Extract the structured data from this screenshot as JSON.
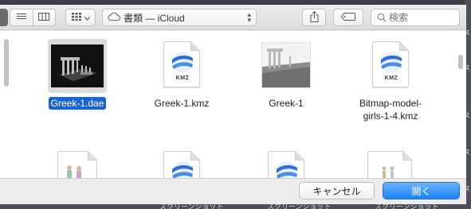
{
  "toolbar": {
    "location": "書類 — iCloud",
    "search_placeholder": "検索"
  },
  "files": [
    {
      "name": "Greek-1.dae",
      "type": "dae",
      "selected": true
    },
    {
      "name": "Greek-1.kmz",
      "type": "kmz",
      "badge": "KMZ"
    },
    {
      "name": "Greek-1",
      "type": "model"
    },
    {
      "name": "Bitmap-model-girls-1-4.kmz",
      "name_lines": [
        "Bitmap-model-",
        "girls-1-4.kmz"
      ],
      "type": "kmz",
      "badge": "KMZ"
    },
    {
      "name": "",
      "type": "figures-doc"
    },
    {
      "name": "",
      "type": "kmz"
    },
    {
      "name": "",
      "type": "kmz"
    },
    {
      "name": "",
      "type": "figures-doc"
    }
  ],
  "footer": {
    "cancel_label": "キャンセル",
    "open_label": "開く"
  },
  "desktop": {
    "labels": [
      "スクリーンショット",
      "スクリーンショット",
      "スクリーンショット",
      "スクリーンショット"
    ]
  },
  "colors": {
    "accent": "#1a63d4",
    "open_button": "#1a82fb",
    "window_bg": "#ececec"
  }
}
